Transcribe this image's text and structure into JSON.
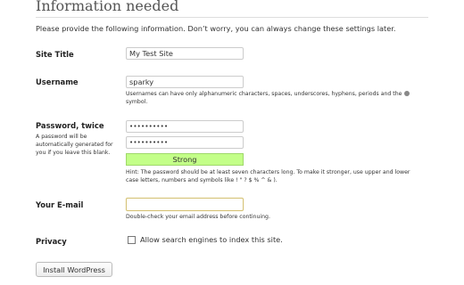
{
  "heading": "Information needed",
  "intro": "Please provide the following information. Don’t worry, you can always change these settings later.",
  "site_title": {
    "label": "Site Title",
    "value": "My Test Site"
  },
  "username": {
    "label": "Username",
    "value": "sparky",
    "help_line1": "Usernames can have only alphanumeric characters, spaces, underscores, hyphens, periods and the",
    "help_line2": "symbol."
  },
  "password": {
    "label": "Password, twice",
    "note": "A password will be automatically generated for you if you leave this blank.",
    "value1": "••••••••••",
    "value2": "••••••••••",
    "strength": "Strong",
    "hint_line1": "Hint: The password should be at least seven characters long. To make it stronger, use upper and lower",
    "hint_line2": "case letters, numbers and symbols like ! \" ? $ % ^ & )."
  },
  "email": {
    "label": "Your E-mail",
    "value": "",
    "help": "Double-check your email address before continuing."
  },
  "privacy": {
    "label": "Privacy",
    "checkbox_label": "Allow search engines to index this site.",
    "checked": false
  },
  "install_button": "Install WordPress",
  "colors": {
    "strength_bg": "#c3ff88",
    "focus_border": "#d5c277"
  },
  "icons": {
    "at_symbol": "at-symbol-icon"
  }
}
